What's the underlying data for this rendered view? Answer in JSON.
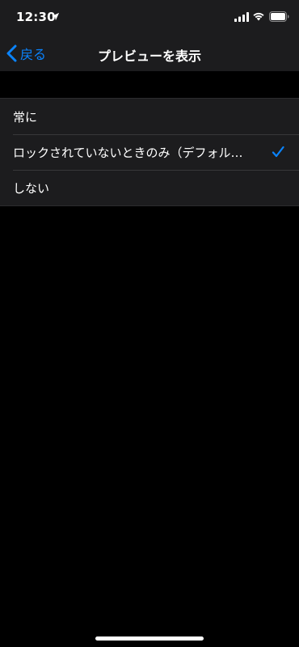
{
  "status_bar": {
    "time": "12:30"
  },
  "nav": {
    "back_label": "戻る",
    "title": "プレビューを表示"
  },
  "options": [
    {
      "label": "常に",
      "selected": false
    },
    {
      "label": "ロックされていないときのみ（デフォル…",
      "selected": true
    },
    {
      "label": "しない",
      "selected": false
    }
  ],
  "colors": {
    "accent": "#0a84ff",
    "background": "#000000",
    "cell": "#1c1c1e"
  },
  "icons": {
    "back": "chevron-left-icon",
    "selected": "checkmark-icon",
    "location": "location-arrow-icon",
    "signal": "cellular-signal-icon",
    "wifi": "wifi-icon",
    "battery": "battery-icon"
  }
}
